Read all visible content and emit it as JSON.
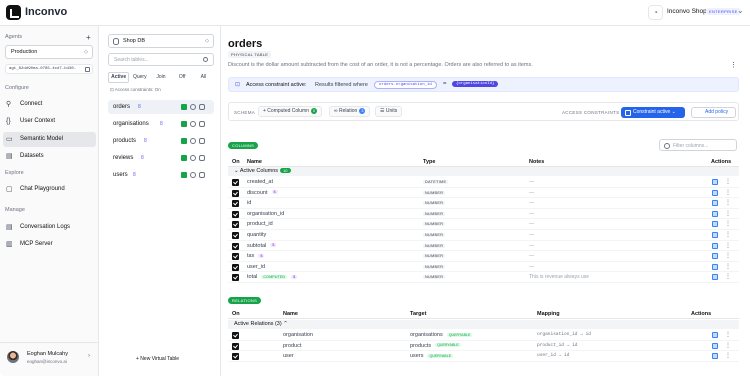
{
  "app": {
    "name": "Inconvo"
  },
  "topbar": {
    "shop_name": "Inconvo Shop",
    "plan_badge": "ENTERPRISE"
  },
  "sidebar": {
    "agents_label": "Agents",
    "environment": "Production",
    "agent_id": "agt_82dd90ea-0785-4cd7-b430-",
    "configure_label": "Configure",
    "configure_items": [
      {
        "label": "Connect",
        "icon": "connect-icon"
      },
      {
        "label": "User Context",
        "icon": "user-context-icon"
      },
      {
        "label": "Semantic Model",
        "icon": "semantic-model-icon",
        "active": true
      },
      {
        "label": "Datasets",
        "icon": "datasets-icon"
      }
    ],
    "explore_label": "Explore",
    "explore_items": [
      {
        "label": "Chat Playground",
        "icon": "chat-icon"
      }
    ],
    "manage_label": "Manage",
    "manage_items": [
      {
        "label": "Conversation Logs",
        "icon": "logs-icon"
      },
      {
        "label": "MCP Server",
        "icon": "mcp-server-icon"
      }
    ],
    "user": {
      "name": "Eoghan Mulcahy",
      "email": "eoghan@inconvo.ai"
    }
  },
  "tables_panel": {
    "database": "Shop DB",
    "search_placeholder": "Search tables...",
    "filter_tabs": [
      "Active",
      "Query",
      "Join",
      "Off",
      "All"
    ],
    "active_filter": "Active",
    "access_note": "Access constraints: On",
    "tables": [
      {
        "name": "orders",
        "count": "8",
        "active": true
      },
      {
        "name": "organisations",
        "count": "8"
      },
      {
        "name": "products",
        "count": "8"
      },
      {
        "name": "reviews",
        "count": "8"
      },
      {
        "name": "users",
        "count": "8"
      }
    ],
    "new_virtual_label": "+ New Virtual Table"
  },
  "main": {
    "title": "orders",
    "table_kind": "PHYSICAL TABLE",
    "description": "Discount is the dollar amount subtracted from the cost of an order, it is not a percentage. Orders are also referred to as items.",
    "access_banner": {
      "title": "Access constraint active:",
      "text": "Results filtered where",
      "filter_field": "orders.organisation_id",
      "operator": "=",
      "filter_value": "{organisationId}"
    },
    "schema": {
      "label": "SCHEMA",
      "pills": [
        {
          "label": "+ Computed Column",
          "count": "0",
          "color": "#16a34a"
        },
        {
          "label": "Relation",
          "count": "3",
          "color": "#3b82f6"
        },
        {
          "label": "Units",
          "count": ""
        }
      ],
      "access_label": "ACCESS CONSTRAINTS",
      "constraint_button": "Constraint active",
      "add_policy_button": "Add policy"
    },
    "columns": {
      "section_label": "COLUMNS",
      "filter_placeholder": "Filter columns...",
      "headers": {
        "on": "On",
        "name": "Name",
        "type": "Type",
        "notes": "Notes",
        "actions": "Actions"
      },
      "group_label": "Active Columns",
      "group_count": "10",
      "rows": [
        {
          "name": "created_at",
          "type": "DATETIME",
          "notes": "—",
          "badge": "",
          "computed": false
        },
        {
          "name": "discount",
          "type": "NUMBER",
          "notes": "—",
          "badge": "$",
          "computed": false
        },
        {
          "name": "id",
          "type": "NUMBER",
          "notes": "—",
          "badge": "",
          "computed": false
        },
        {
          "name": "organisation_id",
          "type": "NUMBER",
          "notes": "—",
          "badge": "",
          "computed": false
        },
        {
          "name": "product_id",
          "type": "NUMBER",
          "notes": "—",
          "badge": "",
          "computed": false
        },
        {
          "name": "quantity",
          "type": "NUMBER",
          "notes": "—",
          "badge": "",
          "computed": false
        },
        {
          "name": "subtotal",
          "type": "NUMBER",
          "notes": "—",
          "badge": "$",
          "computed": false
        },
        {
          "name": "tax",
          "type": "NUMBER",
          "notes": "—",
          "badge": "$",
          "computed": false
        },
        {
          "name": "user_id",
          "type": "NUMBER",
          "notes": "—",
          "badge": "",
          "computed": false
        },
        {
          "name": "total",
          "type": "NUMBER",
          "notes": "This is revenue always use",
          "badge": "$",
          "computed": true,
          "computed_label": "COMPUTED"
        }
      ]
    },
    "relations": {
      "section_label": "RELATIONS",
      "headers": {
        "on": "On",
        "name": "Name",
        "target": "Target",
        "mapping": "Mapping",
        "actions": "Actions"
      },
      "group_label": "Active Relations (3)",
      "rows": [
        {
          "name": "organisation",
          "target": "organisations",
          "badge": "QUERYABLE",
          "mapping": "organisation_id → id"
        },
        {
          "name": "product",
          "target": "products",
          "badge": "QUERYABLE",
          "mapping": "product_id → id"
        },
        {
          "name": "user",
          "target": "users",
          "badge": "QUERYABLE",
          "mapping": "user_id → id"
        }
      ]
    }
  }
}
